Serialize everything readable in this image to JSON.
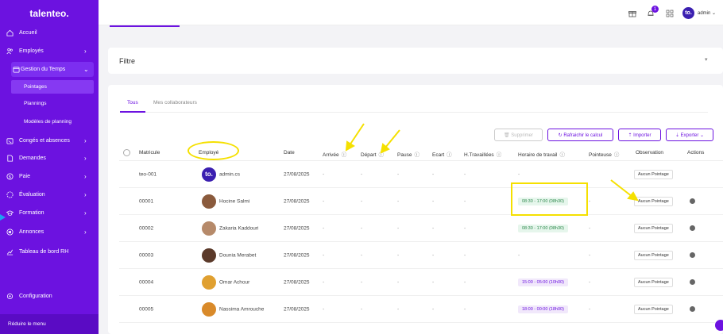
{
  "app": {
    "logo": "talenteo.",
    "collapse_label": "Réduire le menu"
  },
  "sidebar": {
    "items": [
      {
        "label": "Accueil",
        "icon": "home-icon",
        "chevron": ""
      },
      {
        "label": "Employés",
        "icon": "users-icon",
        "chevron": "›"
      },
      {
        "label": "Gestion du Temps",
        "icon": "calendar-icon",
        "chevron": "⌄"
      },
      {
        "label": "Congés et absences",
        "icon": "calendar-off-icon",
        "chevron": "›"
      },
      {
        "label": "Demandes",
        "icon": "document-icon",
        "chevron": "›"
      },
      {
        "label": "Paie",
        "icon": "dollar-icon",
        "chevron": "›"
      },
      {
        "label": "Évaluation",
        "icon": "circle-icon",
        "chevron": "›"
      },
      {
        "label": "Formation",
        "icon": "graduation-icon",
        "chevron": "›"
      },
      {
        "label": "Annonces",
        "icon": "megaphone-icon",
        "chevron": "›"
      },
      {
        "label": "Tableau de bord RH",
        "icon": "chart-icon",
        "chevron": ""
      },
      {
        "label": "Configuration",
        "icon": "gear-icon",
        "chevron": ""
      }
    ],
    "subitems": [
      {
        "label": "Pointages",
        "selected": true
      },
      {
        "label": "Plannings",
        "selected": false
      },
      {
        "label": "Modèles de planning",
        "selected": false
      }
    ]
  },
  "topbar": {
    "notification_count": "1",
    "avatar_text": "to.",
    "user": "admin ⌄"
  },
  "filter": {
    "title": "Filtre",
    "chevron": "▾"
  },
  "tabs": [
    {
      "label": "Tous"
    },
    {
      "label": "Mes collaborateurs"
    }
  ],
  "toolbar": {
    "delete_label": "🗑 Supprimer",
    "refresh_label": "↻ Rafraichir le calcul",
    "import_label": "⇡ Importer",
    "export_label": "⇣ Exporter ⌄"
  },
  "table": {
    "columns": [
      "Matricule",
      "Employé",
      "Date",
      "Arrivée",
      "Départ",
      "Pause",
      "Ecart",
      "H.Travaillées",
      "Horaire de travail",
      "Pointeuse",
      "Observation",
      "Actions"
    ],
    "info_glyph": "ⓘ",
    "rows": [
      {
        "matricule": "teo-001",
        "employee": "admin.cs",
        "avatar": "to.",
        "date": "27/08/2025",
        "arrivee": "-",
        "depart": "-",
        "pause": "-",
        "ecart": "-",
        "htrav": "-",
        "horaire": "-",
        "pointeuse": "",
        "observation": "Aucun Pointage",
        "action": false
      },
      {
        "matricule": "00001",
        "employee": "Hocine Salmi",
        "avatar": "",
        "date": "27/08/2025",
        "arrivee": "-",
        "depart": "-",
        "pause": "-",
        "ecart": "-",
        "htrav": "-",
        "horaire": "08:30 - 17:00 (08h30)",
        "horaire_style": "green",
        "pointeuse": "-",
        "observation": "Aucun Pointage",
        "action": true
      },
      {
        "matricule": "00002",
        "employee": "Zakaria Kaddouri",
        "avatar": "",
        "date": "27/08/2025",
        "arrivee": "-",
        "depart": "-",
        "pause": "-",
        "ecart": "-",
        "htrav": "-",
        "horaire": "08:30 - 17:00 (08h30)",
        "horaire_style": "green",
        "pointeuse": "-",
        "observation": "Aucun Pointage",
        "action": true
      },
      {
        "matricule": "00003",
        "employee": "Dounia Merabet",
        "avatar": "",
        "date": "27/08/2025",
        "arrivee": "-",
        "depart": "-",
        "pause": "-",
        "ecart": "-",
        "htrav": "-",
        "horaire": "-",
        "pointeuse": "-",
        "observation": "Aucun Pointage",
        "action": true
      },
      {
        "matricule": "00004",
        "employee": "Omar Achour",
        "avatar": "",
        "date": "27/08/2025",
        "arrivee": "-",
        "depart": "-",
        "pause": "-",
        "ecart": "-",
        "htrav": "-",
        "horaire": "15:00 - 05:00 (10h00)",
        "horaire_style": "purple",
        "pointeuse": "-",
        "observation": "Aucun Pointage",
        "action": true
      },
      {
        "matricule": "00005",
        "employee": "Nassima Amrouche",
        "avatar": "",
        "date": "27/08/2025",
        "arrivee": "-",
        "depart": "-",
        "pause": "-",
        "ecart": "-",
        "htrav": "-",
        "horaire": "18:00 - 00:00 (18h00)",
        "horaire_style": "purple",
        "pointeuse": "-",
        "observation": "Aucun Pointage",
        "action": true
      }
    ]
  },
  "colors": {
    "brand": "#6c12e0",
    "annotation": "#f5e000",
    "pointer": "#1da1f2"
  }
}
